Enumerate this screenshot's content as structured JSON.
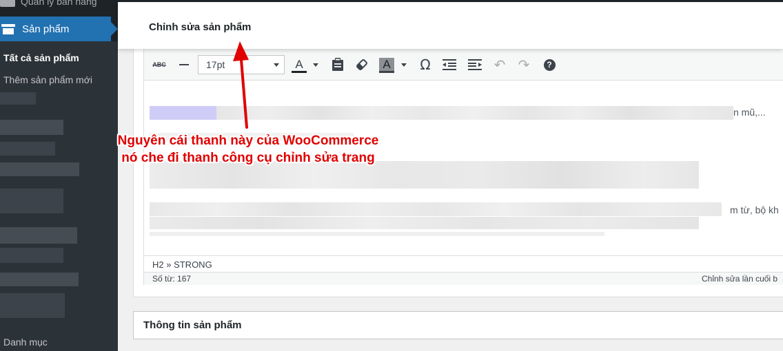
{
  "sidebar": {
    "top_item": "Quản lý bán hàng",
    "active_item": "Sản phẩm",
    "submenu": [
      "Tất cả sản phẩm",
      "Thêm sản phẩm mới"
    ],
    "bottom_item": "Danh mục"
  },
  "header": {
    "title": "Chỉnh sửa sản phẩm"
  },
  "editor": {
    "font_size": "17pt",
    "content_fragments": [
      "n mũ,...",
      "m từ, bộ kh"
    ],
    "path": "H2 » STRONG",
    "word_count": "Số từ: 167",
    "last_edit": "Chỉnh sửa lần cuối b"
  },
  "product_info": {
    "title": "Thông tin sản phẩm"
  },
  "annotation": {
    "line1": "Nguyên cái thanh này của WooCommerce",
    "line2": "nó che đi thanh công cụ chỉnh sửa trang"
  },
  "colors": {
    "accent": "#2271b1",
    "annotation": "#e00000",
    "sidebar": "#1d2327"
  }
}
